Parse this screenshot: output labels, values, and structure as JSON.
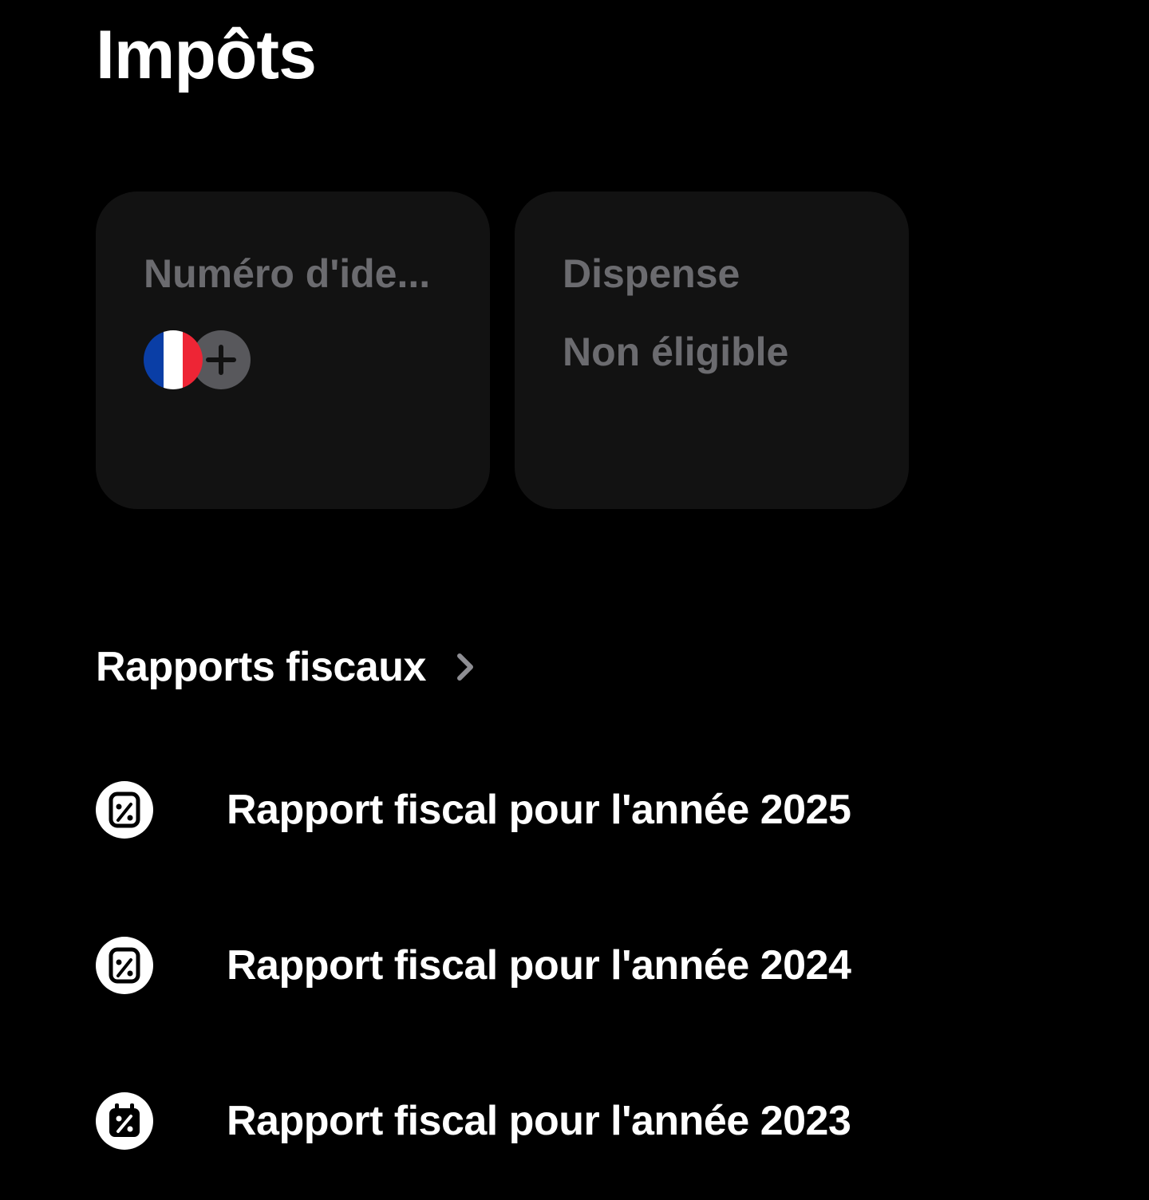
{
  "page": {
    "title": "Impôts"
  },
  "cards": {
    "tax_id": {
      "label": "Numéro d'ide...",
      "flag_icon": "france-flag-icon",
      "flag_colors": [
        "#0a3ea6",
        "#ffffff",
        "#ee2535"
      ],
      "add_icon": "plus-icon"
    },
    "exemption": {
      "label": "Dispense",
      "value": "Non éligible"
    }
  },
  "reports_section": {
    "title": "Rapports fiscaux",
    "chevron_icon": "chevron-right-icon",
    "items": [
      {
        "label": "Rapport fiscal pour l'année 2025",
        "icon": "tax-document-percent-icon"
      },
      {
        "label": "Rapport fiscal pour l'année 2024",
        "icon": "tax-document-percent-icon"
      },
      {
        "label": "Rapport fiscal pour l'année 2023",
        "icon": "tax-calendar-percent-icon"
      }
    ]
  },
  "colors": {
    "background": "#000000",
    "card_background": "#121212",
    "muted_text": "#6b6b6f",
    "primary_text": "#ffffff",
    "plus_circle": "#58585c"
  }
}
